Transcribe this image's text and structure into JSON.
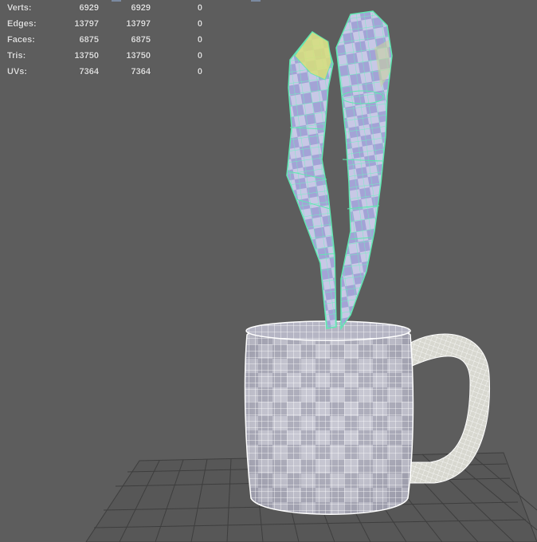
{
  "heads_up_display": {
    "rows": [
      {
        "label": "Verts:",
        "values": [
          "6929",
          "6929",
          "0"
        ]
      },
      {
        "label": "Edges:",
        "values": [
          "13797",
          "13797",
          "0"
        ]
      },
      {
        "label": "Faces:",
        "values": [
          "6875",
          "6875",
          "0"
        ]
      },
      {
        "label": "Tris:",
        "values": [
          "13750",
          "13750",
          "0"
        ]
      },
      {
        "label": "UVs:",
        "values": [
          "7364",
          "7364",
          "0"
        ]
      }
    ]
  },
  "colors": {
    "viewport_background": "#5d5d5d",
    "grid_lines": "#3c3c3c",
    "mug_wireframe": "#ffffff",
    "leaf_selection": "#5ee8b0",
    "leaf_fill": "#a8a8d8",
    "leaf_highlight": "#d8e07a"
  },
  "objects": {
    "mug": {
      "icon": "mug-mesh"
    },
    "leaves": {
      "icon": "plant-leaves-mesh"
    },
    "ground_grid": {
      "icon": "grid-plane"
    }
  }
}
